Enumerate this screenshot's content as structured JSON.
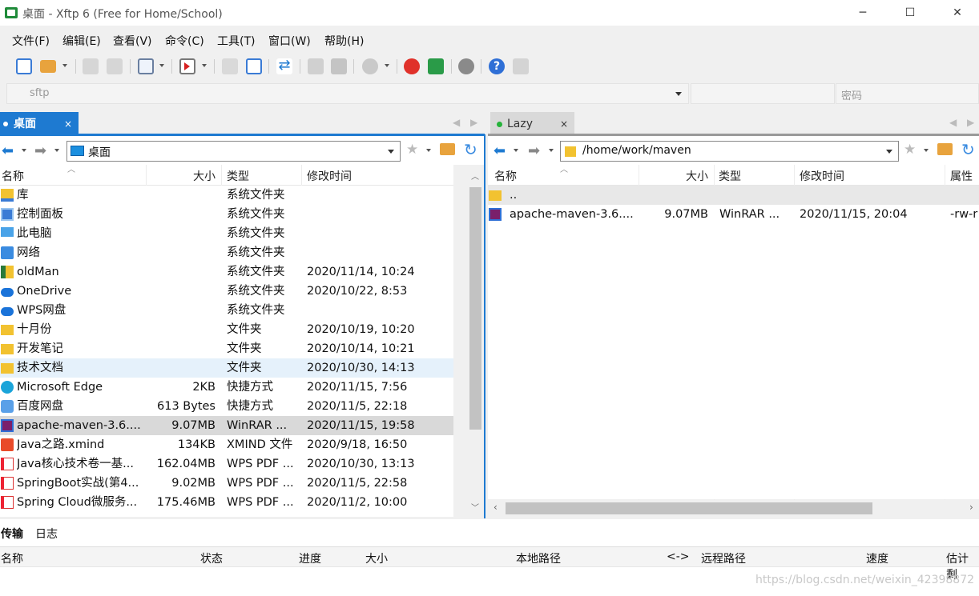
{
  "window": {
    "title": "桌面 - Xftp 6 (Free for Home/School)",
    "minimize": "─",
    "maximize": "☐",
    "close": "✕"
  },
  "menu": [
    "文件(F)",
    "编辑(E)",
    "查看(V)",
    "命令(C)",
    "工具(T)",
    "窗口(W)",
    "帮助(H)"
  ],
  "address": {
    "host_placeholder": "sftp",
    "password_placeholder": "密码"
  },
  "left": {
    "tab": "桌面",
    "tab_close": "×",
    "path": "桌面",
    "headers": [
      "名称",
      "大小",
      "类型",
      "修改时间"
    ],
    "rows": [
      {
        "name": "库",
        "size": "",
        "type": "系统文件夹",
        "mtime": "",
        "icon": "library-icon"
      },
      {
        "name": "控制面板",
        "size": "",
        "type": "系统文件夹",
        "mtime": "",
        "icon": "control-panel-icon"
      },
      {
        "name": "此电脑",
        "size": "",
        "type": "系统文件夹",
        "mtime": "",
        "icon": "computer-icon"
      },
      {
        "name": "网络",
        "size": "",
        "type": "系统文件夹",
        "mtime": "",
        "icon": "network-icon"
      },
      {
        "name": "oldMan",
        "size": "",
        "type": "系统文件夹",
        "mtime": "2020/11/14, 10:24",
        "icon": "user-folder-icon"
      },
      {
        "name": "OneDrive",
        "size": "",
        "type": "系统文件夹",
        "mtime": "2020/10/22, 8:53",
        "icon": "cloud-icon"
      },
      {
        "name": "WPS网盘",
        "size": "",
        "type": "系统文件夹",
        "mtime": "",
        "icon": "cloud-icon"
      },
      {
        "name": "十月份",
        "size": "",
        "type": "文件夹",
        "mtime": "2020/10/19, 10:20",
        "icon": "folder-icon"
      },
      {
        "name": "开发笔记",
        "size": "",
        "type": "文件夹",
        "mtime": "2020/10/14, 10:21",
        "icon": "folder-icon"
      },
      {
        "name": "技术文档",
        "size": "",
        "type": "文件夹",
        "mtime": "2020/10/30, 14:13",
        "icon": "folder-icon"
      },
      {
        "name": "Microsoft Edge",
        "size": "2KB",
        "type": "快捷方式",
        "mtime": "2020/11/15, 7:56",
        "icon": "edge-icon"
      },
      {
        "name": "百度网盘",
        "size": "613 Bytes",
        "type": "快捷方式",
        "mtime": "2020/11/5, 22:18",
        "icon": "baidu-icon"
      },
      {
        "name": "apache-maven-3.6....",
        "size": "9.07MB",
        "type": "WinRAR ...",
        "mtime": "2020/11/15, 19:58",
        "icon": "winrar-icon"
      },
      {
        "name": "Java之路.xmind",
        "size": "134KB",
        "type": "XMIND 文件",
        "mtime": "2020/9/18, 16:50",
        "icon": "xmind-icon"
      },
      {
        "name": "Java核心技术卷一基...",
        "size": "162.04MB",
        "type": "WPS PDF ...",
        "mtime": "2020/10/30, 13:13",
        "icon": "pdf-icon"
      },
      {
        "name": "SpringBoot实战(第4...",
        "size": "9.02MB",
        "type": "WPS PDF ...",
        "mtime": "2020/11/5, 22:58",
        "icon": "pdf-icon"
      },
      {
        "name": "Spring Cloud微服务...",
        "size": "175.46MB",
        "type": "WPS PDF ...",
        "mtime": "2020/11/2, 10:00",
        "icon": "pdf-icon"
      }
    ]
  },
  "right": {
    "tab": "Lazy",
    "tab_close": "×",
    "path": "/home/work/maven",
    "headers": [
      "名称",
      "大小",
      "类型",
      "修改时间",
      "属性"
    ],
    "rows": [
      {
        "name": "..",
        "size": "",
        "type": "",
        "mtime": "",
        "attr": "",
        "icon": "folder-icon"
      },
      {
        "name": "apache-maven-3.6....",
        "size": "9.07MB",
        "type": "WinRAR ...",
        "mtime": "2020/11/15, 20:04",
        "attr": "-rw-r",
        "icon": "winrar-icon"
      }
    ]
  },
  "transfer": {
    "tabs": [
      "传输",
      "日志"
    ],
    "headers": [
      "名称",
      "状态",
      "进度",
      "大小",
      "本地路径",
      "<->",
      "远程路径",
      "速度",
      "估计剩"
    ]
  },
  "watermark": "https://blog.csdn.net/weixin_42398872"
}
